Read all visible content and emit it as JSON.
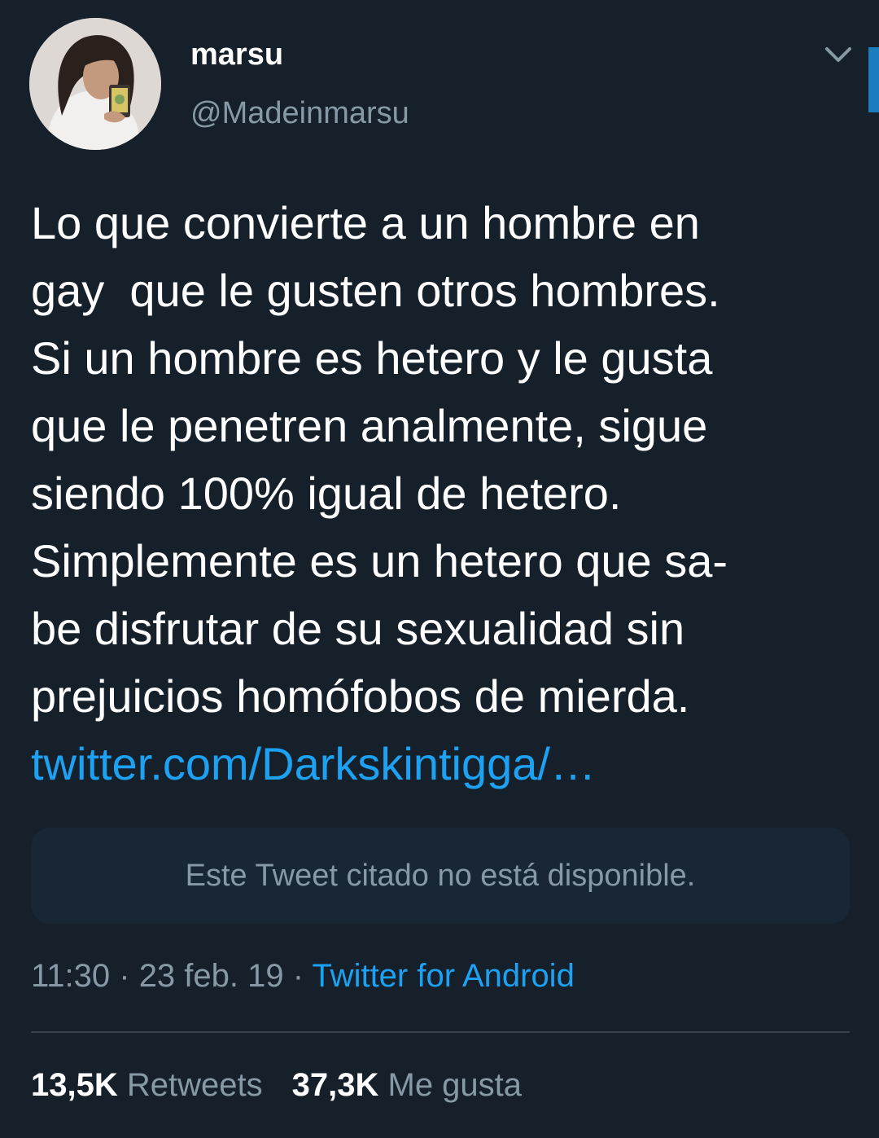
{
  "user": {
    "display_name": "marsu",
    "handle": "@Madeinmarsu"
  },
  "tweet": {
    "lines": [
      "Lo que convierte a un hombre en",
      "gay  que le gusten otros hombres.",
      "Si un hombre es hetero y le gusta",
      "que le penetren analmente, sigue",
      "siendo 100% igual de hetero.",
      "Simplemente es un hetero que sa-",
      "be disfrutar de su sexualidad sin",
      "prejuicios homófobos de mierda."
    ],
    "link": "twitter.com/Darkskintigga/…"
  },
  "quoted_tweet": {
    "text": "Este Tweet citado no está disponible."
  },
  "meta": {
    "time": "11:30",
    "sep1": " · ",
    "date": "23 feb. 19",
    "sep2": " · ",
    "source": "Twitter for Android"
  },
  "stats": {
    "retweets_count": "13,5K",
    "retweets_label": "Retweets",
    "likes_count": "37,3K",
    "likes_label": "Me gusta"
  },
  "icons": {
    "menu": "chevron-down-icon"
  },
  "colors": {
    "background": "#15202b",
    "link": "#1da1f2",
    "secondary_text": "#8899a6"
  }
}
